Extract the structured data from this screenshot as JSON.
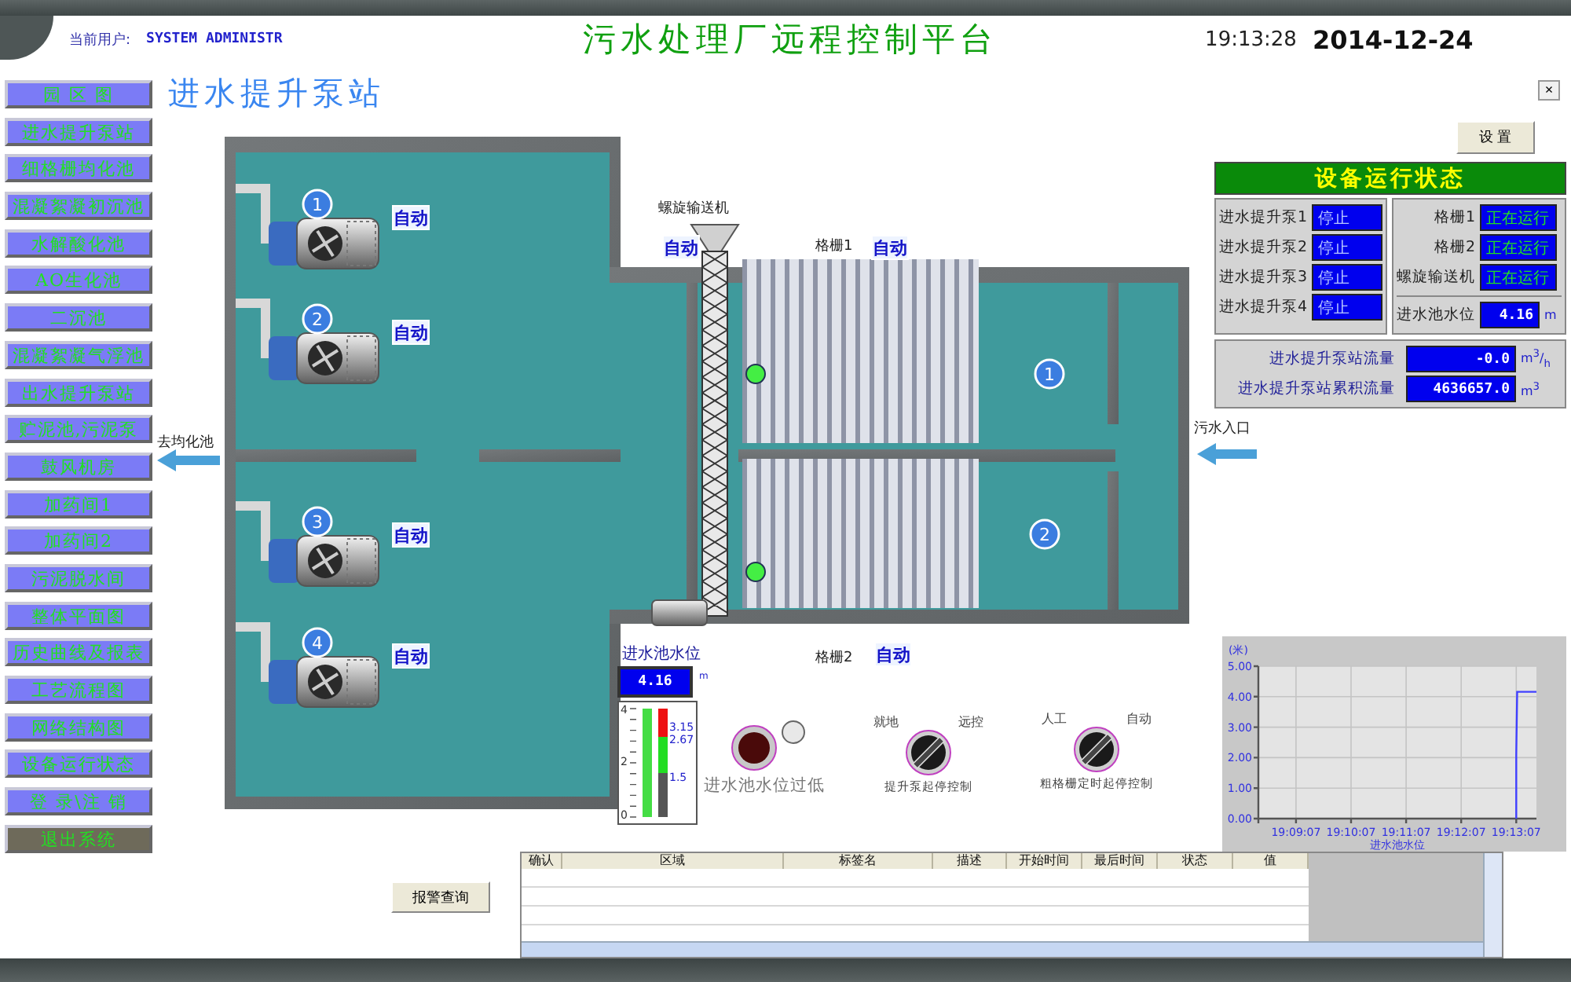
{
  "header": {
    "user_label": "当前用户:",
    "user": "SYSTEM ADMINISTR",
    "title": "污水处理厂远程控制平台",
    "time": "19:13:28",
    "date": "2014-12-24",
    "close": "×"
  },
  "page_title": "进水提升泵站",
  "sidebar": [
    {
      "label": "园 区 图",
      "kind": "nav"
    },
    {
      "label": "进水提升泵站",
      "kind": "nav"
    },
    {
      "label": "细格栅均化池",
      "kind": "nav"
    },
    {
      "label": "混凝絮凝初沉池",
      "kind": "nav"
    },
    {
      "label": "水解酸化池",
      "kind": "nav"
    },
    {
      "label": "AO生化池",
      "kind": "nav"
    },
    {
      "label": "二沉池",
      "kind": "nav"
    },
    {
      "label": "混凝絮凝气浮池",
      "kind": "nav"
    },
    {
      "label": "出水提升泵站",
      "kind": "nav"
    },
    {
      "label": "贮泥池,污泥泵",
      "kind": "nav"
    },
    {
      "label": "鼓风机房",
      "kind": "nav"
    },
    {
      "label": "加药间1",
      "kind": "nav"
    },
    {
      "label": "加药间2",
      "kind": "nav"
    },
    {
      "label": "污泥脱水间",
      "kind": "nav"
    },
    {
      "label": "整体平面图",
      "kind": "nav"
    },
    {
      "label": "历史曲线及报表",
      "kind": "nav"
    },
    {
      "label": "工艺流程图",
      "kind": "nav"
    },
    {
      "label": "网络结构图",
      "kind": "nav"
    },
    {
      "label": "设备运行状态",
      "kind": "nav"
    },
    {
      "label": "登 录\\注 销",
      "kind": "nav"
    },
    {
      "label": "退出系统",
      "kind": "exit"
    }
  ],
  "settings_button": "设 置",
  "diagram": {
    "pumps": [
      {
        "number": "1",
        "mode": "自动"
      },
      {
        "number": "2",
        "mode": "自动"
      },
      {
        "number": "3",
        "mode": "自动"
      },
      {
        "number": "4",
        "mode": "自动"
      }
    ],
    "conveyor": {
      "label": "螺旋输送机",
      "mode": "自动",
      "running": true
    },
    "screens": [
      {
        "label": "格栅1",
        "mode": "自动",
        "number": "1"
      },
      {
        "label": "格栅2",
        "mode": "自动",
        "number": "2"
      }
    ],
    "outlet": "去均化池",
    "inlet": "污水入口"
  },
  "status_panel": {
    "title": "设备运行状态",
    "pumps": [
      {
        "label": "进水提升泵1",
        "status": "停止",
        "running": false
      },
      {
        "label": "进水提升泵2",
        "status": "停止",
        "running": false
      },
      {
        "label": "进水提升泵3",
        "status": "停止",
        "running": false
      },
      {
        "label": "进水提升泵4",
        "status": "停止",
        "running": false
      }
    ],
    "equipment": [
      {
        "label": "格栅1",
        "status": "正在运行",
        "running": true
      },
      {
        "label": "格栅2",
        "status": "正在运行",
        "running": true
      },
      {
        "label": "螺旋输送机",
        "status": "正在运行",
        "running": true
      }
    ],
    "water_level": {
      "label": "进水池水位",
      "value": "4.16",
      "unit": "m"
    },
    "flows": [
      {
        "label": "进水提升泵站流量",
        "value": "-0.0",
        "unit": "m$^{3}$/$_{h}$"
      },
      {
        "label": "进水提升泵站累积流量",
        "value": "4636657.0",
        "unit": "m$^{3}$"
      }
    ]
  },
  "level_gauge": {
    "label": "进水池水位",
    "value": "4.16",
    "unit": "m",
    "level": 1,
    "scale": [
      "4",
      "2",
      "0"
    ],
    "marks": [
      "3.15",
      "2.67",
      "1.5"
    ]
  },
  "alarm_light": {
    "label": "进水池水位过低",
    "on": false
  },
  "switches": [
    {
      "left": "就地",
      "right": "远控",
      "caption": "提升泵起停控制",
      "right_selected": true
    },
    {
      "left": "人工",
      "right": "自动",
      "caption": "粗格栅定时起停控制",
      "right_selected": true
    }
  ],
  "trend": {
    "chart_data": {
      "type": "line",
      "ylabel": "(米)",
      "xlabel": "进水池水位",
      "grid": true,
      "x": [
        69187,
        69187,
        69188,
        69209
      ],
      "series": [
        {
          "color": "#4040ff",
          "values": [
            0,
            2.1,
            4.16,
            4.16
          ]
        }
      ],
      "xlim": [
        68906,
        69209
      ],
      "ylim": [
        0,
        5
      ],
      "xticks": [
        {
          "value": 68947,
          "label": "19:09:07"
        },
        {
          "value": 69007,
          "label": "19:10:07"
        },
        {
          "value": 69067,
          "label": "19:11:07"
        },
        {
          "value": 69127,
          "label": "19:12:07"
        },
        {
          "value": 69187,
          "label": "19:13:07"
        }
      ],
      "yticks": [
        {
          "value": 0,
          "label": "0.00"
        },
        {
          "value": 1,
          "label": "1.00"
        },
        {
          "value": 2,
          "label": "2.00"
        },
        {
          "value": 3,
          "label": "3.00"
        },
        {
          "value": 4,
          "label": "4.00"
        },
        {
          "value": 5,
          "label": "5.00"
        }
      ]
    }
  },
  "alarm_button": "报警查询",
  "alarm_table": {
    "columns": [
      "确认",
      "区域",
      "标签名",
      "描述",
      "开始时间",
      "最后时间",
      "状态",
      "值"
    ]
  }
}
